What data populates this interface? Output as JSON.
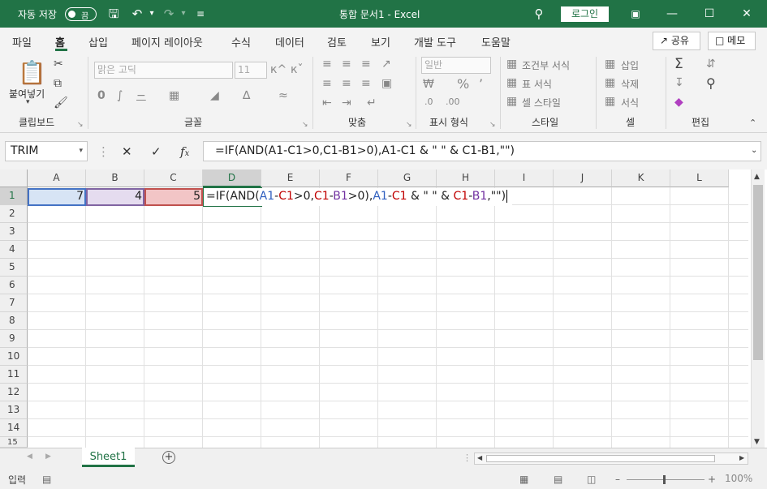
{
  "titlebar": {
    "autosave_label": "자동 저장",
    "autosave_state": "끔",
    "doc_title": "통합 문서1  -  Excel",
    "login_label": "로그인"
  },
  "tabs": [
    "파일",
    "홈",
    "삽입",
    "페이지 레이아웃",
    "수식",
    "데이터",
    "검토",
    "보기",
    "개발 도구",
    "도움말"
  ],
  "share_label": "공유",
  "memo_label": "메모",
  "ribbon": {
    "clipboard": {
      "paste": "붙여넣기",
      "group": "클립보드"
    },
    "font": {
      "name": "맑은 고딕",
      "size": "11",
      "group": "글꼴"
    },
    "align": {
      "group": "맞춤"
    },
    "number": {
      "format": "일반",
      "group": "표시 형식"
    },
    "styles": {
      "cond": "조건부 서식",
      "table": "표 서식",
      "cell": "셀 스타일",
      "group": "스타일"
    },
    "cells": {
      "insert": "삽입",
      "delete": "삭제",
      "format": "서식",
      "group": "셀"
    },
    "edit": {
      "group": "편집"
    }
  },
  "namebox": "TRIM",
  "formula": "=IF(AND(A1-C1>0,C1-B1>0),A1-C1 & \" \" & C1-B1,\"\")",
  "formula_tokens": {
    "p1": "=IF(AND(",
    "a1": "A1",
    "m1": "-",
    "c1": "C1",
    "p2": ">0,",
    "c1b": "C1",
    "m2": "-",
    "b1": "B1",
    "p3": ">0),",
    "a1b": "A1",
    "m3": "-",
    "c1c": "C1",
    "p4": " & \" \" & ",
    "c1d": "C1",
    "m4": "-",
    "b1b": "B1",
    "p5": ",\"\")"
  },
  "columns": [
    "A",
    "B",
    "C",
    "D",
    "E",
    "F",
    "G",
    "H",
    "I",
    "J",
    "K",
    "L"
  ],
  "rows": [
    "1",
    "2",
    "3",
    "4",
    "5",
    "6",
    "7",
    "8",
    "9",
    "10",
    "11",
    "12",
    "13",
    "14",
    "15"
  ],
  "cells": {
    "A1": "7",
    "B1": "4",
    "C1": "5"
  },
  "sheet_tab": "Sheet1",
  "status": {
    "mode": "입력",
    "zoom": "100%"
  },
  "colors": {
    "accent": "#217346",
    "ref_blue": "#2f5fbf",
    "ref_red": "#c00000",
    "ref_purple": "#7030a0"
  }
}
